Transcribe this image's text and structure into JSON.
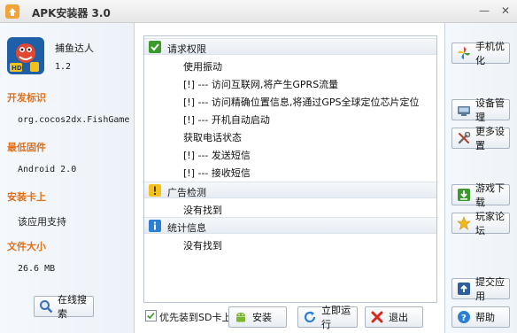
{
  "window": {
    "title": "APK安装器 3.0",
    "min_glyph": "—",
    "close_glyph": "✕"
  },
  "app": {
    "name": "捕鱼达人",
    "version": "1.2",
    "icon": "fishing-game-icon"
  },
  "info": {
    "developer_label": "开发标识",
    "developer_value": "org.cocos2dx.FishGame",
    "firmware_label": "最低固件",
    "firmware_value": "Android 2.0",
    "sdcard_label": "安装卡上",
    "sdcard_value": "该应用支持",
    "size_label": "文件大小",
    "size_value": "26.6 MB"
  },
  "buttons": {
    "online_search": "在线搜索",
    "install": "安装",
    "run_now": "立即运行",
    "exit": "退出",
    "phone_optimize": "手机优化",
    "device_manage": "设备管理",
    "more_settings": "更多设置",
    "game_download": "游戏下载",
    "player_forum": "玩家论坛",
    "submit_app": "提交应用",
    "help": "帮助"
  },
  "checkbox": {
    "label": "优先装到SD卡上",
    "checked": true
  },
  "list": {
    "permissions": {
      "label": "请求权限",
      "items": [
        "使用振动",
        "[!] --- 访问互联网,将产生GPRS流量",
        "[!] --- 访问精确位置信息,将通过GPS全球定位芯片定位",
        "[!] --- 开机自动启动",
        "获取电话状态",
        "[!] --- 发送短信",
        "[!] --- 接收短信"
      ]
    },
    "ads": {
      "label": "广告检测",
      "items": [
        "没有找到"
      ]
    },
    "stats": {
      "label": "统计信息",
      "items": [
        "没有找到"
      ]
    }
  },
  "colors": {
    "section_label": "#e0701a",
    "check_green": "#3a9a2a",
    "warn_yellow": "#f2c21a",
    "info_blue": "#2d7fd3"
  }
}
